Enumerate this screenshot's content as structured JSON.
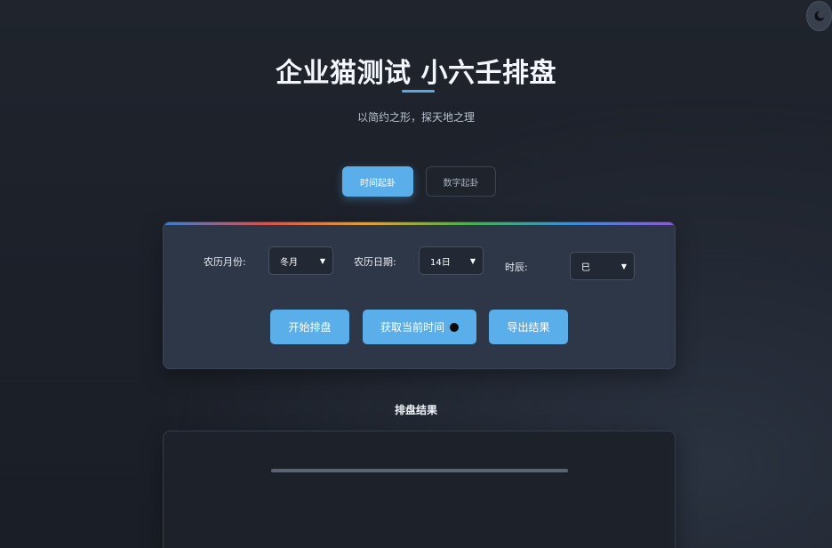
{
  "theme_toggle": {
    "icon": "moon-icon"
  },
  "header": {
    "title": "企业猫测试 小六壬排盘",
    "subtitle": "以简约之形，探天地之理"
  },
  "tabs": [
    {
      "label": "时间起卦",
      "active": true
    },
    {
      "label": "数字起卦",
      "active": false
    }
  ],
  "form": {
    "month_label": "农历月份:",
    "month_value": "冬月",
    "day_label": "农历日期:",
    "day_value": "14日",
    "hour_label": "时辰:",
    "hour_value": "巳"
  },
  "actions": {
    "start": "开始排盘",
    "now": "获取当前时间",
    "export": "导出结果"
  },
  "result": {
    "title": "排盘结果"
  },
  "colors": {
    "accent": "#5aaee9",
    "background": "#1e232c",
    "panel": "#2e3747"
  }
}
